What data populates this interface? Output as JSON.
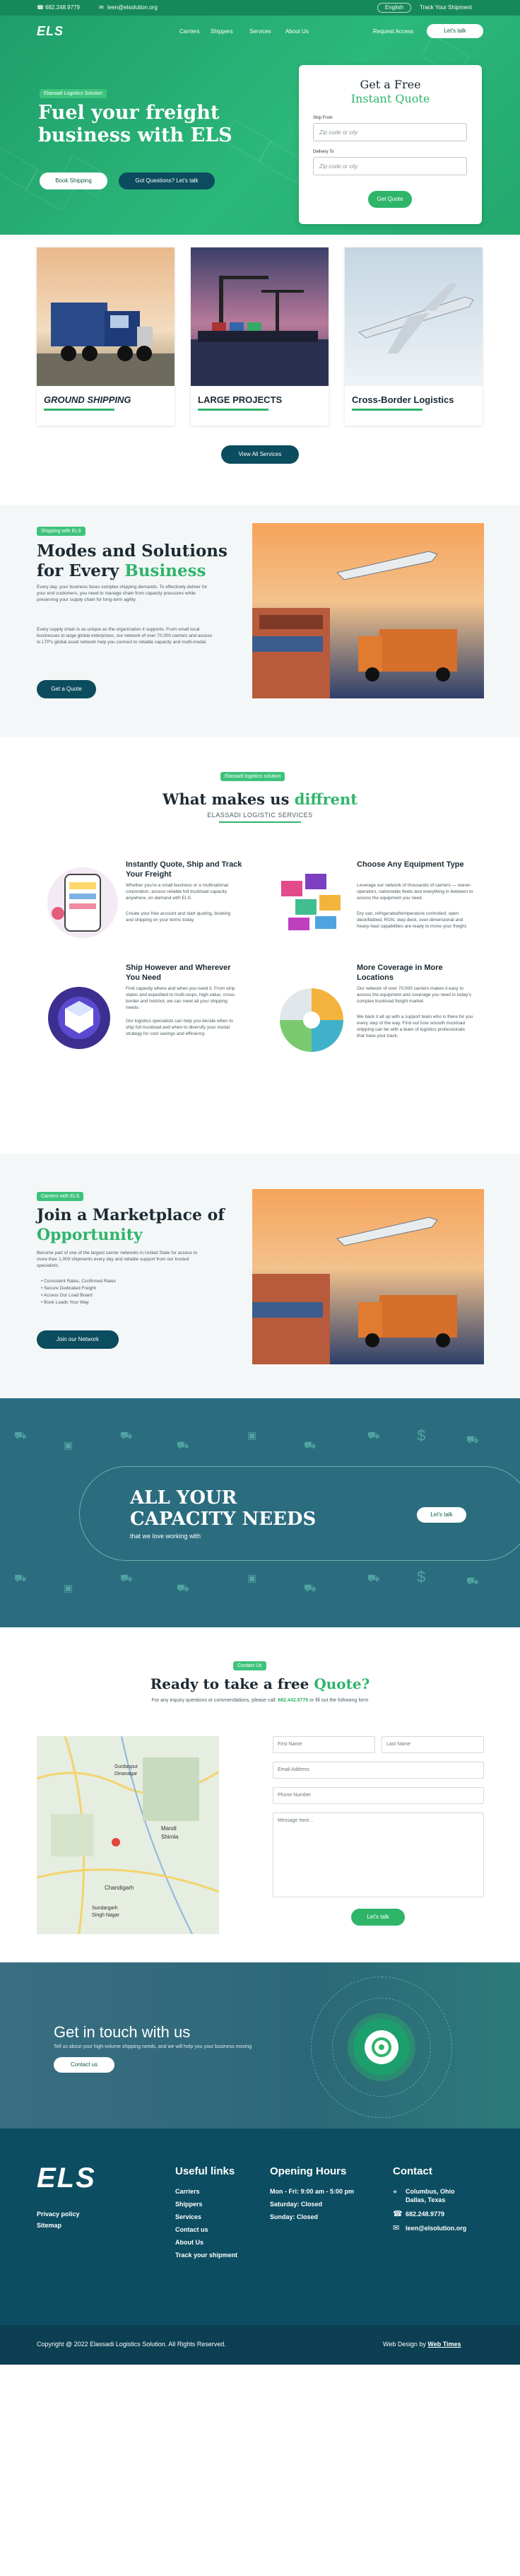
{
  "topbar": {
    "phone": "682.248.9779",
    "email": "leen@elsolution.org",
    "language": "English",
    "track_label": "Track Your Shipment"
  },
  "nav": {
    "logo": "ELS",
    "items": [
      "Carriers",
      "Shippers",
      "Services",
      "About Us"
    ],
    "request_access": "Request Access",
    "talk_button": "Let's talk"
  },
  "hero": {
    "badge": "Elassadi Logistics Solution",
    "title": "Fuel your freight business with ELS",
    "book_button": "Book Shipping",
    "questions_button": "Got Questions? Let's talk"
  },
  "quote_form": {
    "title_line1": "Get a Free",
    "title_line2": "Instant Quote",
    "from_label": "Ship From",
    "from_placeholder": "Zip code or city",
    "to_label": "Delivery To",
    "to_placeholder": "Zip code or city",
    "submit": "Get Quote"
  },
  "services": {
    "cards": [
      {
        "title": "GROUND SHIPPING"
      },
      {
        "title": "LARGE PROJECTS"
      },
      {
        "title": "Cross-Border Logistics"
      }
    ],
    "view_all": "View All Services"
  },
  "modes": {
    "badge": "Shipping with ELS",
    "title_line1": "Modes and Solutions",
    "title_line2a": "for Every ",
    "title_line2b": "Business",
    "para1": "Every day, your business faces complex shipping demands. To effectively deliver for your end customers, you need to manage chain from capacity pressures while preserving your supply chain for long-term agility.",
    "para2": "Every supply chain is as unique as the organization it supports. From small local businesses to large global enterprises, our network of over 70,000 carriers and access to LTP's global asset network help you connect to reliable capacity and multi-modal.",
    "button": "Get a Quote"
  },
  "why": {
    "badge": "Elassadi logistics solution",
    "title_a": "What makes us ",
    "title_b": "diffrent",
    "subtitle": "ELASSADI LOGISTIC SERVICES",
    "features": [
      {
        "title": "Instantly Quote, Ship and Track Your Freight",
        "text": "Whether you're a small business or a multinational corporation, access reliable full truckload capacity anywhere, on demand with ELS.",
        "text2": "Create your free account and start quoting, booking and shipping on your terms today."
      },
      {
        "title": "Choose Any Equipment Type",
        "text": "Leverage our network of thousands of carriers — owner-operators, nationwide fleets and everything in between to access the equipment you need.",
        "text2": "Dry van, refrigerated/temperature controlled, open deck/flatbed, RGN, step deck, over-dimensional and heavy-haul capabilities are ready to move your freight."
      },
      {
        "title": "Ship However and Wherever You Need",
        "text": "Find capacity where and when you need it. From strip states and expedited to multi-stops, high-value, cross-border and hotshot, we can meet all your shipping needs.",
        "text2": "Our logistics specialists can help you decide when to ship full truckload and when to diversify your modal strategy for cost savings and efficiency."
      },
      {
        "title": "More Coverage in More Locations",
        "text": "Our network of over 70,000 carriers makes it easy to access the equipment and coverage you need in today's complex truckload freight market.",
        "text2": "We back it all up with a support team who is there for you every step of the way. Find out how smooth truckload shipping can be with a team of logistics professionals that have your back."
      }
    ]
  },
  "marketplace": {
    "badge": "Carriers with ELS",
    "title_line1": "Join a Marketplace of",
    "title_line2": "Opportunity",
    "para": "Become part of one of the largest carrier networks in United State for access to more than 1,000 shipments every day and reliable support from our trusted specialists.",
    "bullets": [
      "Consistent Rates, Confirmed Rates",
      "Secure Dedicated Freight",
      "Access Our Load Board",
      "Book Loads Your Way"
    ],
    "button": "Join our Network"
  },
  "capacity": {
    "title_line1": "ALL YOUR",
    "title_line2": "CAPACITY NEEDS",
    "subtitle": "that we love working with",
    "button": "Let's talk"
  },
  "contact": {
    "badge": "Contact Us",
    "title_a": "Ready to take a free ",
    "title_b": "Quote?",
    "intro_a": "For any inquiry questions or commendations, please call: ",
    "intro_phone": "682.442.9779",
    "intro_b": " or fill out the following form",
    "first_name": "First Name",
    "last_name": "Last Name",
    "email": "Email Address",
    "phone": "Phone Number",
    "message": "Message here...",
    "submit": "Let's talk",
    "map_labels": [
      "Gurdaspur",
      "Dinanagar",
      "Mandi",
      "Shimla",
      "Chandigarh",
      "Sundargarh",
      "Singh Nagar"
    ]
  },
  "getintouch": {
    "title": "Get in touch with us",
    "text": "Tell us about your high-volume shipping needs, and we will help you your business moving",
    "button": "Contact us"
  },
  "footer": {
    "logo": "ELS",
    "left_links": [
      "Privacy policy",
      "Sitemap"
    ],
    "useful_title": "Useful links",
    "useful_links": [
      "Carriers",
      "Shippers",
      "Services",
      "Contact us",
      "About Us",
      "Track your shipment"
    ],
    "hours_title": "Opening Hours",
    "hours": [
      "Mon - Fri: 9:00 am - 5:00 pm",
      "Saturday: Closed",
      "Sunday: Closed"
    ],
    "contact_title": "Contact",
    "address_line1": "Columbus, Ohio",
    "address_line2": "Dallas, Texas",
    "phone": "682.248.9779",
    "email": "leen@elsolution.org"
  },
  "copyright": {
    "text": "Copyright @ 2022 Elassadi Logistics Solution. All Rights Reserved.",
    "design_a": "Web Design by ",
    "design_b": "Web Times"
  },
  "colors": {
    "brand_green": "#2eb56a",
    "dark_teal": "#0b4c5e",
    "footer": "#0c4d61"
  }
}
